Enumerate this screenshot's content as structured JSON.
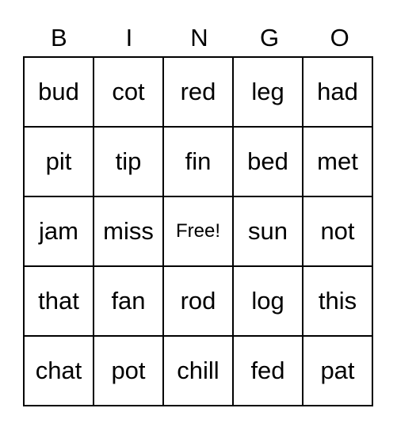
{
  "header": [
    "B",
    "I",
    "N",
    "G",
    "O"
  ],
  "rows": [
    [
      "bud",
      "cot",
      "red",
      "leg",
      "had"
    ],
    [
      "pit",
      "tip",
      "fin",
      "bed",
      "met"
    ],
    [
      "jam",
      "miss",
      "Free!",
      "sun",
      "not"
    ],
    [
      "that",
      "fan",
      "rod",
      "log",
      "this"
    ],
    [
      "chat",
      "pot",
      "chill",
      "fed",
      "pat"
    ]
  ]
}
